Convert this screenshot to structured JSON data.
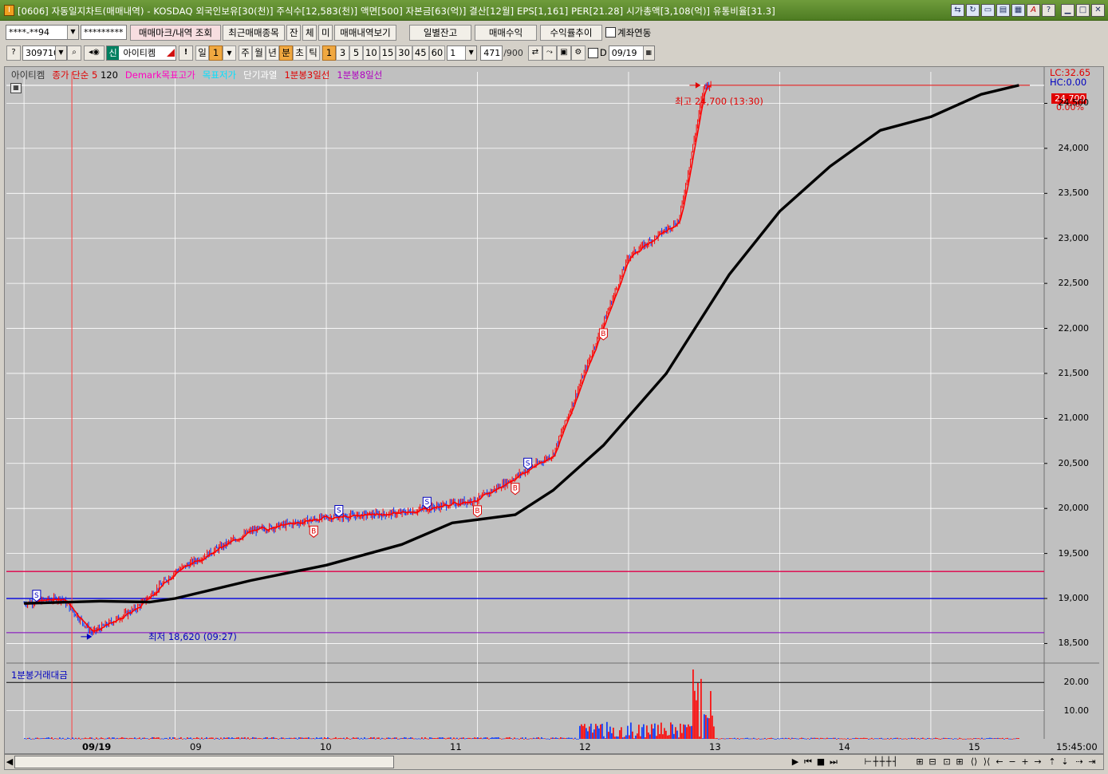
{
  "window": {
    "title": "[0606] 자동일지차트(매매내역) - KOSDAQ 외국인보유[30(천)] 주식수[12,583(천)] 액면[500] 자본금[63(억)] 결산[12월] EPS[1,161] PER[21.28] 시가총액[3,108(억)] 유통비율[31.3]",
    "icon": "I"
  },
  "toolbar1": {
    "account": "****-**94",
    "password": "*********",
    "mark_query": "매매마크/내역 조회",
    "recent_items": "최근매매종목",
    "jan": "잔",
    "che": "체",
    "mi": "미",
    "history_view": "매매내역보기",
    "daily_balance": "일별잔고",
    "trade_profit": "매매수익",
    "return_trend": "수익률추이",
    "account_link": "계좌연동"
  },
  "toolbar2": {
    "code": "309710",
    "sin": "신",
    "stock_name": "아이티켐",
    "period_day": "일",
    "period_num": "1",
    "week": "주",
    "month": "월",
    "year": "년",
    "minute": "분",
    "second": "초",
    "tick": "틱",
    "intervals": [
      "1",
      "3",
      "5",
      "10",
      "15",
      "30",
      "45",
      "60"
    ],
    "count": "1",
    "progress": "471",
    "total": "/900",
    "d_label": "D",
    "date": "09/19"
  },
  "legend": {
    "stock": "아이티켐",
    "ma": "종가 단순 5",
    "ma_val": "120",
    "demark": "Demark목표고가",
    "target_low": "목표저가",
    "short_over": "단기과열",
    "day3": "1분봉3일선",
    "day8": "1분봉8일선"
  },
  "volume_legend": "1분봉거래대금",
  "price_axis": {
    "lc": "LC:32.65",
    "hc": "HC:0.00",
    "flag": "24,700",
    "flag_pct": "0.00%",
    "ticks": [
      "24,500",
      "24,000",
      "23,500",
      "23,000",
      "22,500",
      "22,000",
      "21,500",
      "21,000",
      "20,500",
      "20,000",
      "19,500",
      "19,000",
      "18,500"
    ]
  },
  "volume_axis": {
    "ticks": [
      "20.00",
      "10.00"
    ]
  },
  "annotations": {
    "high": "최고 24,700 (13:30)",
    "low": "최저 18,620 (09:27)"
  },
  "x_axis": {
    "labels": [
      "09/19",
      "09",
      "10",
      "11",
      "12",
      "13",
      "14",
      "15"
    ],
    "end_time": "15:45:00"
  },
  "colors": {
    "up": "#ff0000",
    "down": "#0033ff",
    "ma_long": "#000000",
    "line_red": "#e0004a",
    "line_blue": "#0000e0",
    "line_purple": "#8000c0"
  },
  "chart_data": {
    "type": "line",
    "title": "",
    "xlabel": "",
    "ylabel": "",
    "ylim": [
      18300,
      24850
    ],
    "x": [
      "09:00",
      "09:15",
      "09:27",
      "09:45",
      "10:00",
      "10:30",
      "11:00",
      "11:30",
      "12:00",
      "12:30",
      "13:00",
      "13:20",
      "13:30"
    ],
    "series": [
      {
        "name": "",
        "values": [
          18950,
          19000,
          18620,
          18900,
          19300,
          19750,
          19900,
          19950,
          20100,
          20600,
          22800,
          23200,
          24700
        ]
      }
    ],
    "markers": {
      "buy": [
        "10:55",
        "12:00",
        "12:15",
        "12:50"
      ],
      "sell": [
        "09:05",
        "11:05",
        "11:40",
        "12:20"
      ]
    }
  }
}
